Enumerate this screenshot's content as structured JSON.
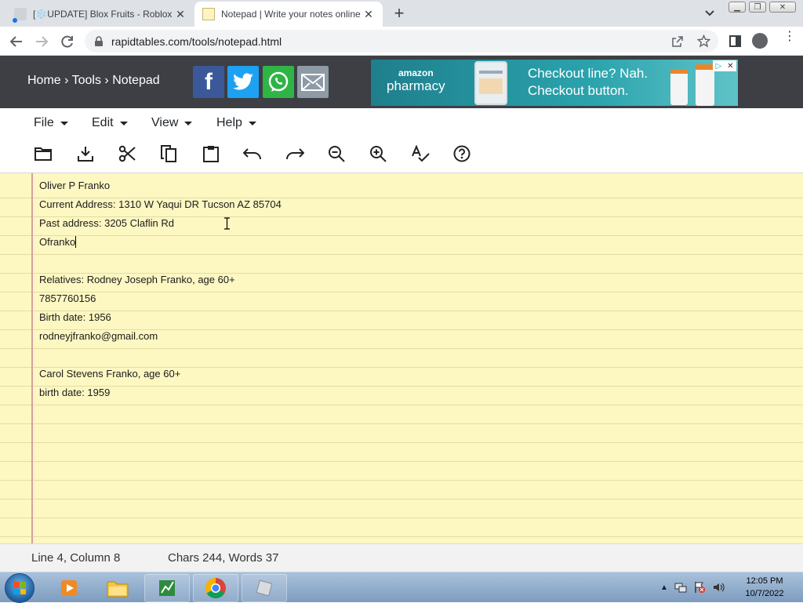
{
  "browser": {
    "tabs": [
      {
        "title": "[❄️UPDATE] Blox Fruits - Roblox",
        "active": false
      },
      {
        "title": "Notepad | Write your notes online",
        "active": true
      }
    ],
    "url": "rapidtables.com/tools/notepad.html"
  },
  "site": {
    "breadcrumb": {
      "home": "Home",
      "sep": " › ",
      "tools": "Tools",
      "current": "Notepad"
    },
    "share": [
      "facebook",
      "twitter",
      "whatsapp",
      "email"
    ],
    "ad": {
      "brand_top": "amazon",
      "brand_bottom": "pharmacy",
      "line1": "Checkout line? Nah.",
      "line2": "Checkout button."
    }
  },
  "menus": [
    "File",
    "Edit",
    "View",
    "Help"
  ],
  "toolbar_icons": [
    "open-folder-icon",
    "download-icon",
    "cut-icon",
    "copy-icon",
    "paste-icon",
    "undo-icon",
    "redo-icon",
    "zoom-out-icon",
    "zoom-in-icon",
    "spellcheck-icon",
    "help-icon"
  ],
  "notes": {
    "lines": [
      "Oliver P Franko",
      "Current Address: 1310 W Yaqui DR Tucson AZ 85704",
      "Past address: 3205 Claflin Rd",
      "Ofranko",
      "",
      "Relatives: Rodney Joseph Franko, age 60+",
      "7857760156",
      "Birth date: 1956",
      "rodneyjfranko@gmail.com",
      "",
      "Carol Stevens Franko, age 60+",
      "birth date: 1959"
    ]
  },
  "status": {
    "position": "Line 4, Column 8",
    "counts": "Chars 244, Words 37"
  },
  "taskbar": {
    "time": "12:05 PM",
    "date": "10/7/2022"
  }
}
